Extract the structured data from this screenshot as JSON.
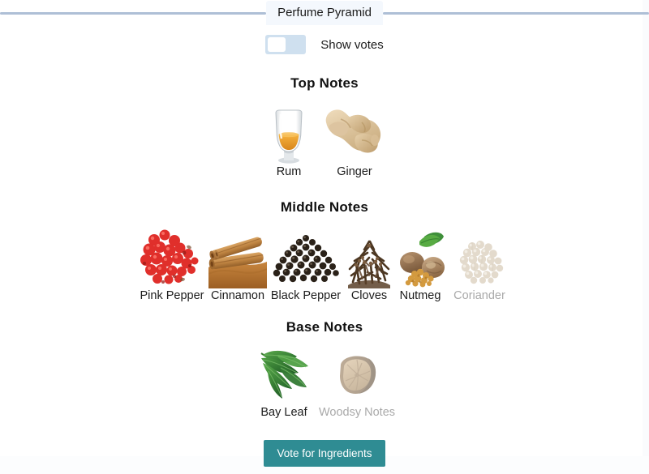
{
  "tab": {
    "label": "Perfume Pyramid"
  },
  "toggle": {
    "label": "Show votes",
    "state": "off",
    "track_color": "#cfe0ef",
    "knob_color": "#ffffff"
  },
  "sections": [
    {
      "title": "Top Notes",
      "items": [
        {
          "label": "Rum",
          "icon": "rum-glass-icon",
          "selected": true
        },
        {
          "label": "Ginger",
          "icon": "ginger-root-icon",
          "selected": true
        }
      ]
    },
    {
      "title": "Middle Notes",
      "items": [
        {
          "label": "Pink Pepper",
          "icon": "pink-peppercorns-icon",
          "selected": true
        },
        {
          "label": "Cinnamon",
          "icon": "cinnamon-sticks-icon",
          "selected": true
        },
        {
          "label": "Black Pepper",
          "icon": "black-peppercorns-icon",
          "selected": true
        },
        {
          "label": "Cloves",
          "icon": "cloves-icon",
          "selected": true
        },
        {
          "label": "Nutmeg",
          "icon": "nutmeg-icon",
          "selected": true
        },
        {
          "label": "Coriander",
          "icon": "coriander-seeds-icon",
          "selected": false
        }
      ]
    },
    {
      "title": "Base Notes",
      "items": [
        {
          "label": "Bay Leaf",
          "icon": "bay-leaf-icon",
          "selected": true
        },
        {
          "label": "Woodsy Notes",
          "icon": "wood-chunk-icon",
          "selected": false
        }
      ]
    }
  ],
  "vote_button": {
    "label": "Vote for Ingredients",
    "color": "#2f8c93"
  }
}
